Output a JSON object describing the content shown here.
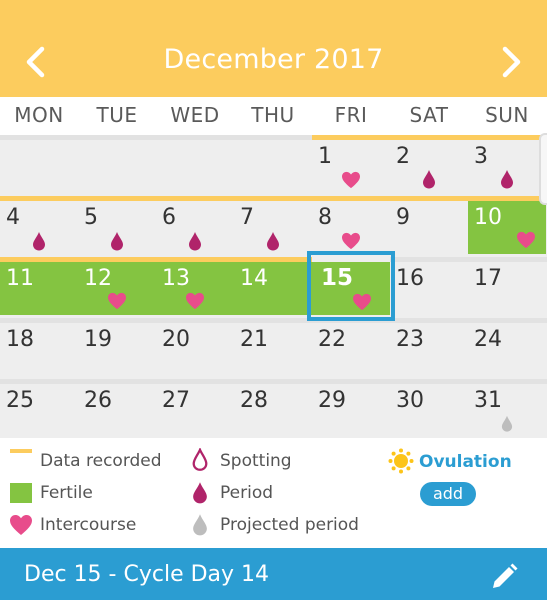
{
  "header": {
    "title": "December 2017"
  },
  "weekdays": [
    "MON",
    "TUE",
    "WED",
    "THU",
    "FRI",
    "SAT",
    "SUN"
  ],
  "calendar": {
    "weeks": [
      [
        "",
        "",
        "",
        "",
        "1",
        "2",
        "3"
      ],
      [
        "4",
        "5",
        "6",
        "7",
        "8",
        "9",
        "10"
      ],
      [
        "11",
        "12",
        "13",
        "14",
        "15",
        "16",
        "17"
      ],
      [
        "18",
        "19",
        "20",
        "21",
        "22",
        "23",
        "24"
      ],
      [
        "25",
        "26",
        "27",
        "28",
        "29",
        "30",
        "31"
      ]
    ],
    "selected_day": "15"
  },
  "legend": {
    "data_recorded": "Data recorded",
    "fertile": "Fertile",
    "intercourse": "Intercourse",
    "spotting": "Spotting",
    "period": "Period",
    "projected_period": "Projected period",
    "ovulation": "Ovulation",
    "add": "add"
  },
  "footer": {
    "title": "Dec 15 - Cycle Day 14"
  },
  "colors": {
    "header": "#fccc5e",
    "fertile": "#84c441",
    "heart": "#e84c8b",
    "period": "#b0246a",
    "projected": "#bdbdbd",
    "accent": "#2b9dd2"
  }
}
